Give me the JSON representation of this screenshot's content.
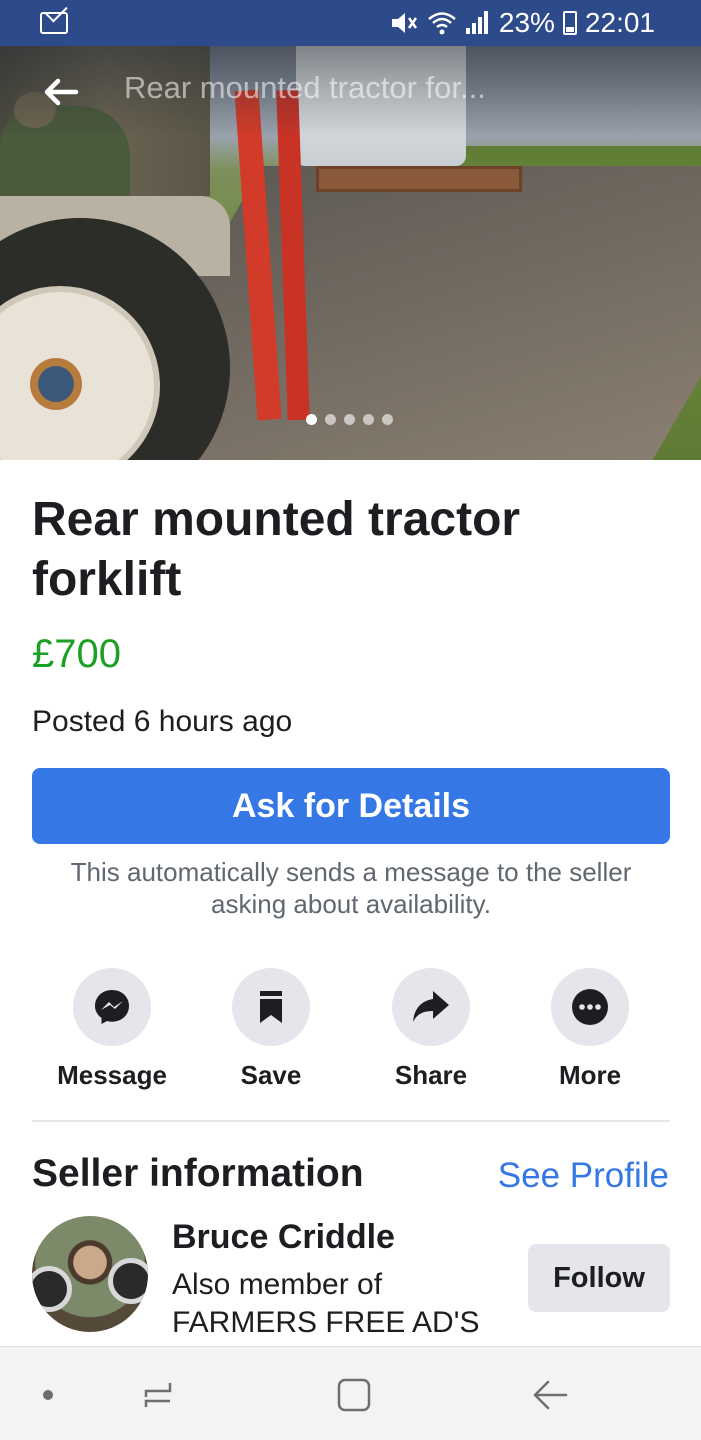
{
  "status_bar": {
    "battery_percent": "23%",
    "time": "22:01",
    "icons": [
      "mail-icon",
      "mute-icon",
      "wifi-icon",
      "signal-icon",
      "battery-icon"
    ]
  },
  "hero": {
    "title": "Rear mounted tractor for...",
    "photo_count": 5,
    "active_photo_index": 0
  },
  "listing": {
    "title": "Rear mounted tractor forklift",
    "price": "£700",
    "posted": "Posted 6 hours ago"
  },
  "ask": {
    "button_label": "Ask for Details",
    "note": "This automatically sends a message to the seller asking about availability."
  },
  "actions": [
    {
      "label": "Message",
      "icon": "messenger-icon"
    },
    {
      "label": "Save",
      "icon": "bookmark-icon"
    },
    {
      "label": "Share",
      "icon": "share-arrow-icon"
    },
    {
      "label": "More",
      "icon": "more-dots-icon"
    }
  ],
  "seller": {
    "heading": "Seller information",
    "see_profile": "See Profile",
    "name": "Bruce Criddle",
    "member_line1": "Also member of",
    "member_line2": "FARMERS FREE AD'S",
    "follow": "Follow"
  },
  "colors": {
    "status_bar": "#2d4a8a",
    "primary": "#3578e5",
    "price": "#1ba024",
    "chip": "#e4e6eb"
  }
}
